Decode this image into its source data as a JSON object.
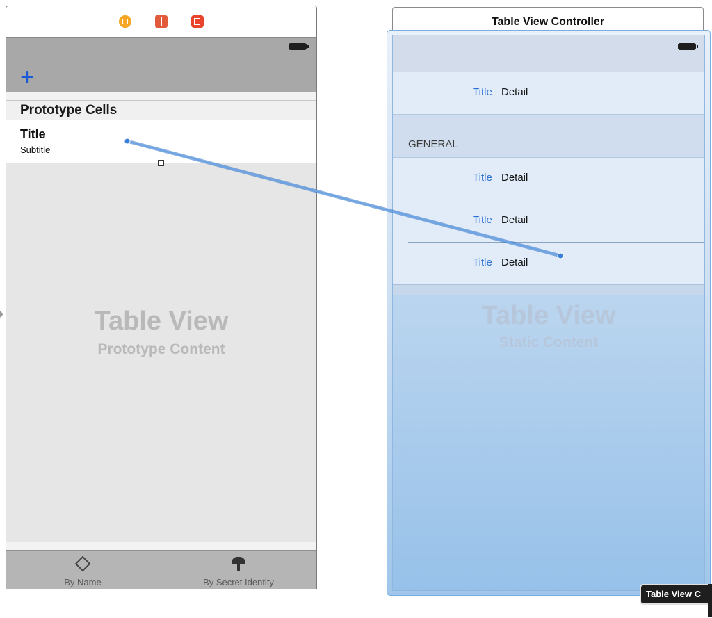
{
  "left_scene": {
    "dock_icons": [
      "view-controller-icon",
      "first-responder-icon",
      "exit-icon"
    ],
    "navbar": {
      "add_label": "+"
    },
    "section_header": "Prototype Cells",
    "cell": {
      "title": "Title",
      "subtitle": "Subtitle"
    },
    "watermark": {
      "line1": "Table View",
      "line2": "Prototype Content"
    },
    "tabs": [
      {
        "label": "By Name",
        "icon": "by-name-icon"
      },
      {
        "label": "By Secret Identity",
        "icon": "secret-identity-icon"
      }
    ]
  },
  "right_scene": {
    "title": "Table View Controller",
    "rows_top": [
      {
        "title": "Title",
        "detail": "Detail"
      }
    ],
    "section_label": "GENERAL",
    "rows_general": [
      {
        "title": "Title",
        "detail": "Detail"
      },
      {
        "title": "Title",
        "detail": "Detail"
      },
      {
        "title": "Title",
        "detail": "Detail"
      }
    ],
    "watermark": {
      "line1": "Table View",
      "line2": "Static Content"
    }
  },
  "tooltip": "Table View C",
  "colors": {
    "accent_blue": "#2d72d2",
    "segue_line": "#4a88d6",
    "navbar_gray": "#a8a8a8"
  }
}
